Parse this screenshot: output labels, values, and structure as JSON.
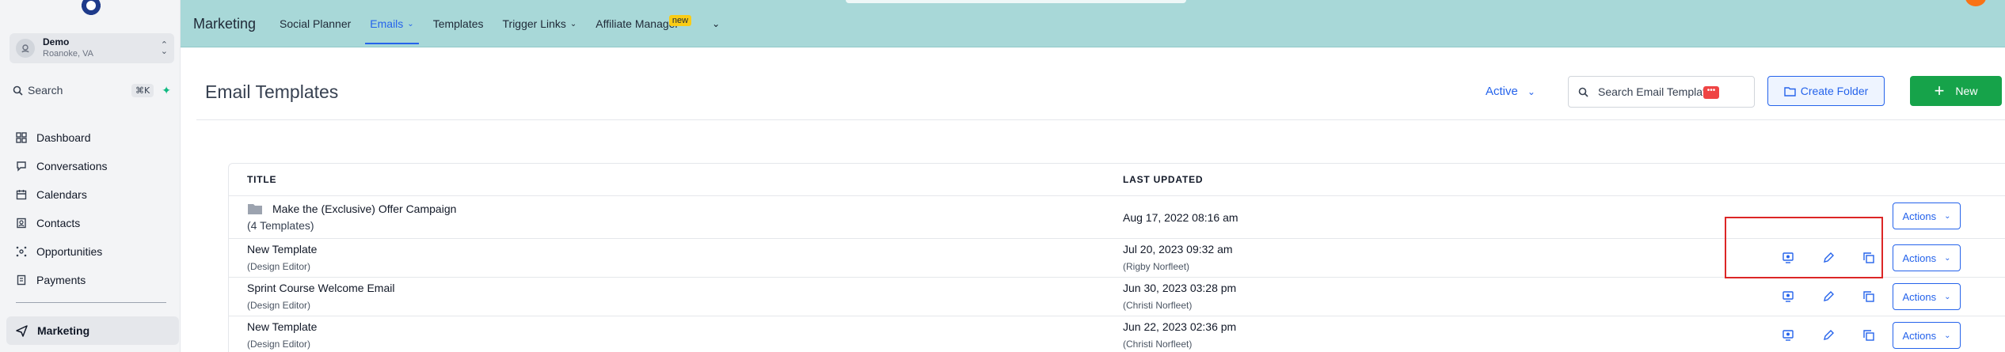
{
  "account": {
    "name": "Demo",
    "location": "Roanoke, VA"
  },
  "sidebar": {
    "search_label": "Search",
    "search_shortcut": "⌘K",
    "items": [
      {
        "label": "Dashboard",
        "icon": "dashboard-icon"
      },
      {
        "label": "Conversations",
        "icon": "chat-icon"
      },
      {
        "label": "Calendars",
        "icon": "calendar-icon"
      },
      {
        "label": "Contacts",
        "icon": "contacts-icon"
      },
      {
        "label": "Opportunities",
        "icon": "opportunities-icon"
      },
      {
        "label": "Payments",
        "icon": "payments-icon"
      }
    ],
    "active_item": {
      "label": "Marketing",
      "icon": "send-icon"
    }
  },
  "topbar": {
    "title": "Marketing",
    "tabs": [
      "Social Planner",
      "Emails",
      "Templates",
      "Trigger Links",
      "Affiliate Manager"
    ],
    "new_badge": "new"
  },
  "page": {
    "title": "Email Templates",
    "status_filter": "Active",
    "search_placeholder": "Search Email Templates",
    "create_folder_label": "Create Folder",
    "new_label": "New"
  },
  "table": {
    "headers": {
      "title": "TITLE",
      "updated": "LAST UPDATED"
    },
    "folder_row": {
      "title": "Make the (Exclusive) Offer Campaign",
      "sub": "(4 Templates)",
      "date": "Aug 17, 2022 08:16 am"
    },
    "rows": [
      {
        "title": "New Template",
        "sub": "(Design Editor)",
        "date": "Jul 20, 2023 09:32 am",
        "by": "(Rigby Norfleet)"
      },
      {
        "title": "Sprint Course Welcome Email",
        "sub": "(Design Editor)",
        "date": "Jun 30, 2023 03:28 pm",
        "by": "(Christi Norfleet)"
      },
      {
        "title": "New Template",
        "sub": "(Design Editor)",
        "date": "Jun 22, 2023 02:36 pm",
        "by": "(Christi Norfleet)"
      }
    ],
    "actions_label": "Actions"
  },
  "colors": {
    "accent": "#2563eb",
    "brand_bar": "#a8d8d8",
    "primary_button": "#16a34a",
    "highlight": "#dc2626"
  }
}
